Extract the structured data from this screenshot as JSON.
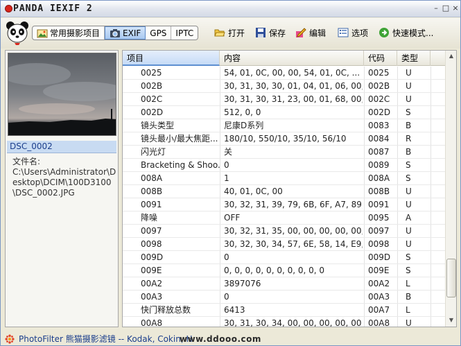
{
  "window": {
    "title": "PANDA IEXIF 2",
    "controls": [
      "–",
      "□",
      "×"
    ]
  },
  "toolbar": {
    "tabs": [
      {
        "label": "常用摄影项目",
        "icon": "photo-icon"
      },
      {
        "label": "EXIF",
        "icon": "camera-icon",
        "active": true
      },
      {
        "label": "GPS"
      },
      {
        "label": "IPTC"
      }
    ],
    "open_label": "打开",
    "save_label": "保存",
    "edit_label": "编辑",
    "options_label": "选项",
    "quick_mode_label": "快速模式..."
  },
  "left_panel": {
    "file_name": "DSC_0002",
    "path_label": "文件名:",
    "path": "C:\\Users\\Administrator\\Desktop\\DCIM\\100D3100\\DSC_0002.JPG"
  },
  "table": {
    "headers": [
      "项目",
      "内容",
      "代码",
      "类型"
    ],
    "rows": [
      [
        "0025",
        "54, 01, 0C, 00, 00, 54, 01, 0C, ...",
        "0025",
        "U"
      ],
      [
        "002B",
        "30, 31, 30, 30, 01, 04, 01, 06, 00, ...",
        "002B",
        "U"
      ],
      [
        "002C",
        "30, 31, 30, 31, 23, 00, 01, 68, 00, ...",
        "002C",
        "U"
      ],
      [
        "002D",
        "512, 0, 0",
        "002D",
        "S"
      ],
      [
        "镜头类型",
        "尼康D系列",
        "0083",
        "B"
      ],
      [
        "镜头最小/最大焦距...",
        "180/10, 550/10, 35/10, 56/10",
        "0084",
        "R"
      ],
      [
        "闪光灯",
        "关",
        "0087",
        "B"
      ],
      [
        "Bracketing & Shoo...",
        "0",
        "0089",
        "S"
      ],
      [
        "008A",
        "1",
        "008A",
        "S"
      ],
      [
        "008B",
        "40, 01, 0C, 00",
        "008B",
        "U"
      ],
      [
        "0091",
        "30, 32, 31, 39, 79, 6B, 6F, A7, 89, ...",
        "0091",
        "U"
      ],
      [
        "降噪",
        "OFF",
        "0095",
        "A"
      ],
      [
        "0097",
        "30, 32, 31, 35, 00, 00, 00, 00, 00, ...",
        "0097",
        "U"
      ],
      [
        "0098",
        "30, 32, 30, 34, 57, 6E, 58, 14, E9, ...",
        "0098",
        "U"
      ],
      [
        "009D",
        "0",
        "009D",
        "S"
      ],
      [
        "009E",
        "0, 0, 0, 0, 0, 0, 0, 0, 0, 0",
        "009E",
        "S"
      ],
      [
        "00A2",
        "3897076",
        "00A2",
        "L"
      ],
      [
        "00A3",
        "0",
        "00A3",
        "B"
      ],
      [
        "快门释放总数",
        "6413",
        "00A7",
        "L"
      ],
      [
        "00A8",
        "30, 31, 30, 34, 00, 00, 00, 00, 00",
        "00A8",
        "U"
      ]
    ]
  },
  "statusbar": {
    "text": "PhotoFilter 熊猫摄影滤镜 -- Kodak, Cokin, H",
    "watermark": "www.ddooo.com"
  },
  "colors": {
    "accent": "#1b3e8c",
    "selection": "#c8dbf2",
    "logo_red": "#d9261c"
  }
}
